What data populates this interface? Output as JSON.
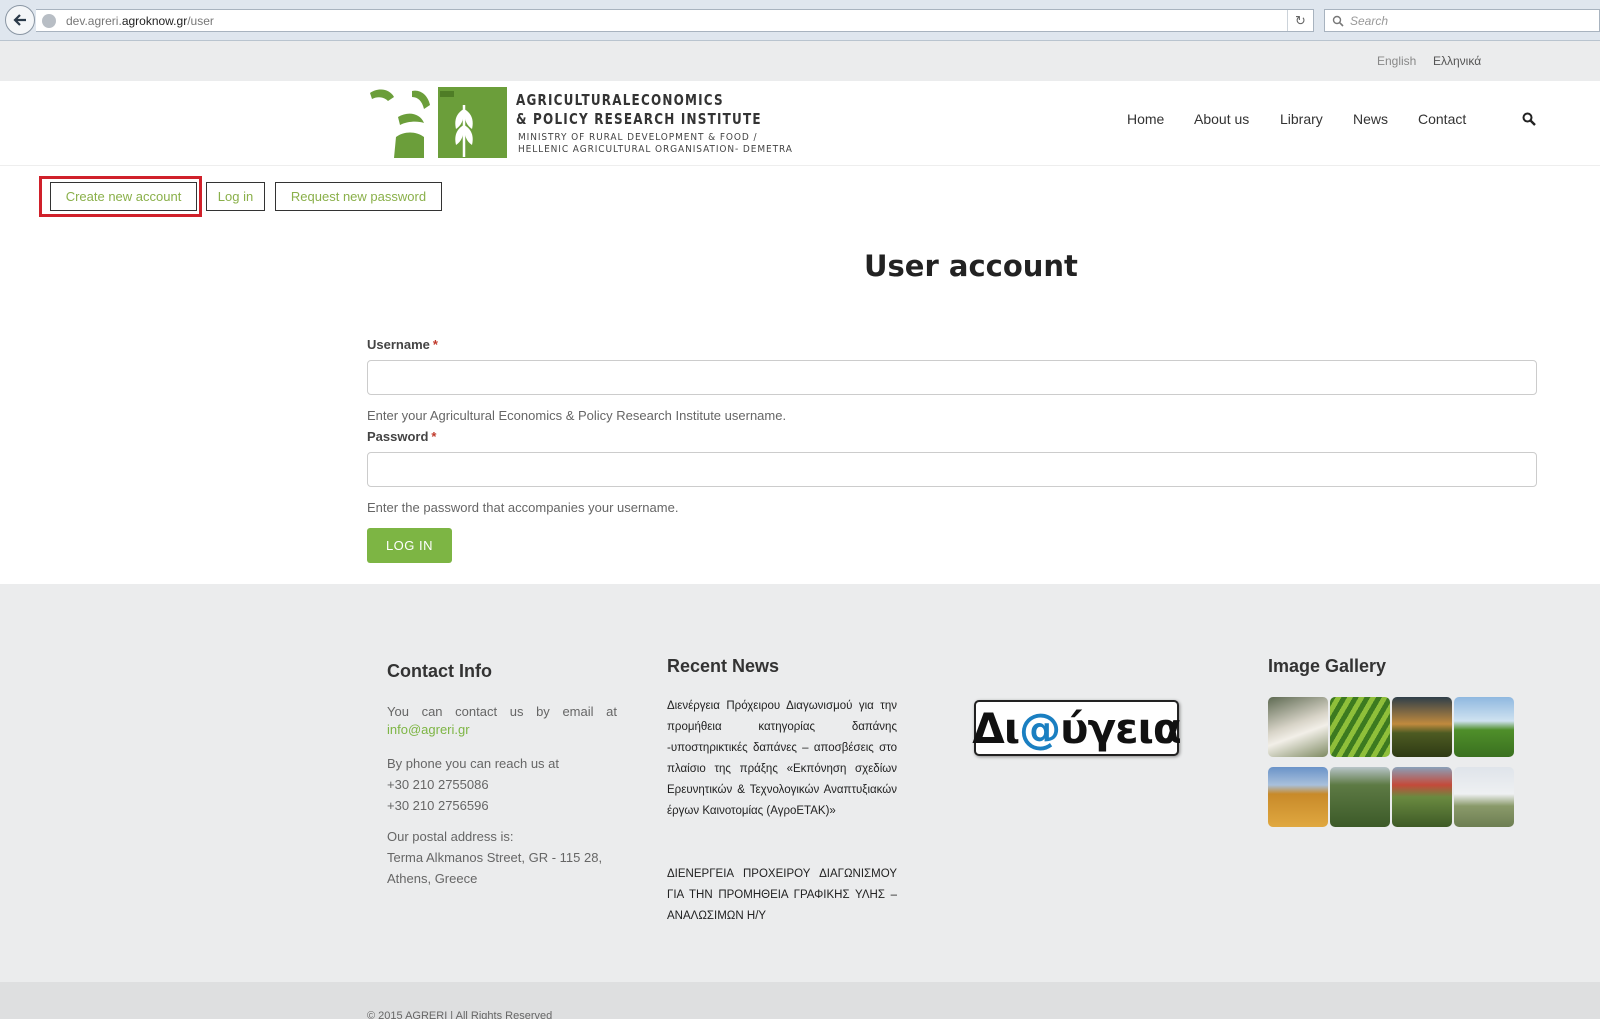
{
  "browser": {
    "url_prefix": "dev.agreri.",
    "url_domain": "agroknow.gr",
    "url_path": "/user",
    "search_placeholder": "Search"
  },
  "languages": [
    "English",
    "Ελληνικά"
  ],
  "logo": {
    "title_line1": "AGRICULTURALECONOMICS",
    "title_line2": "& POLICY RESEARCH INSTITUTE",
    "sub_line1": "MINISTRY OF RURAL DEVELOPMENT & FOOD /",
    "sub_line2": "HELLENIC AGRICULTURAL ORGANISATION- DEMETRA"
  },
  "nav": {
    "home": "Home",
    "about": "About us",
    "library": "Library",
    "news": "News",
    "contact": "Contact"
  },
  "tabs": {
    "create": "Create new account",
    "login": "Log in",
    "request": "Request new password"
  },
  "main": {
    "title": "User account",
    "username_label": "Username",
    "username_help": "Enter your Agricultural Economics & Policy Research Institute username.",
    "password_label": "Password",
    "password_help": "Enter the password that accompanies your username.",
    "required_mark": "*",
    "login_button": "LOG IN"
  },
  "footer": {
    "contact": {
      "heading": "Contact Info",
      "email_intro": "You can contact us by email at",
      "email": "info@agreri.gr",
      "phone_intro": "By phone you can reach us at",
      "phone1": "+30 210 2755086",
      "phone2": "+30 210 2756596",
      "postal_intro": "Our postal address is:",
      "address1": "Terma Alkmanos Street, GR - 115 28,",
      "address2": "Athens, Greece"
    },
    "news": {
      "heading": "Recent News",
      "item1": "Διενέργεια Πρόχειρου Διαγωνισμού για την προμήθεια κατηγορίας δαπάνης -υποστηρικτικές δαπάνες – αποσβέσεις στο πλαίσιο της πράξης «Εκπόνηση σχεδίων Ερευνητικών & Τεχνολογικών Αναπτυξιακών έργων Καινοτομίας (ΑγροΕΤΑΚ)»",
      "item2": "ΔΙΕΝΕΡΓΕΙΑ ΠΡΟΧΕΙΡΟΥ ΔΙΑΓΩΝΙΣΜΟΥ ΓΙΑ ΤΗΝ ΠΡΟΜΗΘΕΙΑ ΓΡΑΦΙΚΗΣ ΥΛΗΣ – ΑΝΑΛΩΣΙΜΩΝ Η/Υ"
    },
    "diavgeia": {
      "prefix": "Δι",
      "at": "@",
      "suffix": "ύγεια"
    },
    "gallery": {
      "heading": "Image Gallery"
    },
    "copyright": "© 2015 AGRERI | All Rights Reserved"
  },
  "colors": {
    "accent_green": "#7db544",
    "highlight_red": "#d0202a"
  },
  "icons": {
    "back": "back-arrow-icon",
    "globe": "globe-icon",
    "reload": "reload-icon",
    "search": "search-icon"
  }
}
